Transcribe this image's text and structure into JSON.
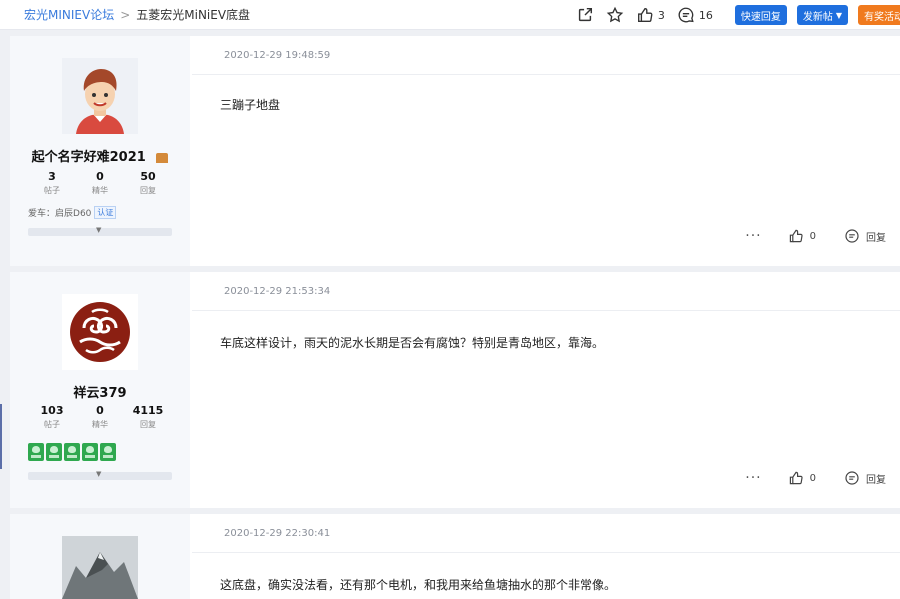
{
  "breadcrumb": {
    "forum": "宏光MINIEV论坛",
    "separator": ">",
    "current": "五菱宏光MiNiEV底盘"
  },
  "toolbar": {
    "like_count": "3",
    "comment_count": "16",
    "quick_reply": "快速回复",
    "new_post": "发新帖",
    "activity": "有奖活动"
  },
  "posts": [
    {
      "username": "起个名字好难2021",
      "stats": [
        {
          "value": "3",
          "label": "帖子"
        },
        {
          "value": "0",
          "label": "精华"
        },
        {
          "value": "50",
          "label": "回复"
        }
      ],
      "car_label": "爱车：",
      "car_model": "启辰D60",
      "car_tag": "认证",
      "timestamp": "2020-12-29 19:48:59",
      "content": "三蹦子地盘",
      "more": "···",
      "likes": "0",
      "reply": "回复"
    },
    {
      "username": "祥云379",
      "stats": [
        {
          "value": "103",
          "label": "帖子"
        },
        {
          "value": "0",
          "label": "精华"
        },
        {
          "value": "4115",
          "label": "回复"
        }
      ],
      "timestamp": "2020-12-29 21:53:34",
      "content": "车底这样设计，雨天的泥水长期是否会有腐蚀？特别是青岛地区，靠海。",
      "more": "···",
      "likes": "0",
      "reply": "回复"
    },
    {
      "timestamp": "2020-12-29 22:30:41",
      "content": "这底盘，确实没法看，还有那个电机，和我用来给鱼塘抽水的那个非常像。"
    }
  ],
  "colors": {
    "accent_blue": "#1f6fde",
    "accent_orange": "#f07a1e",
    "link_blue": "#3a7bdc",
    "badge_green": "#2fa84f"
  }
}
